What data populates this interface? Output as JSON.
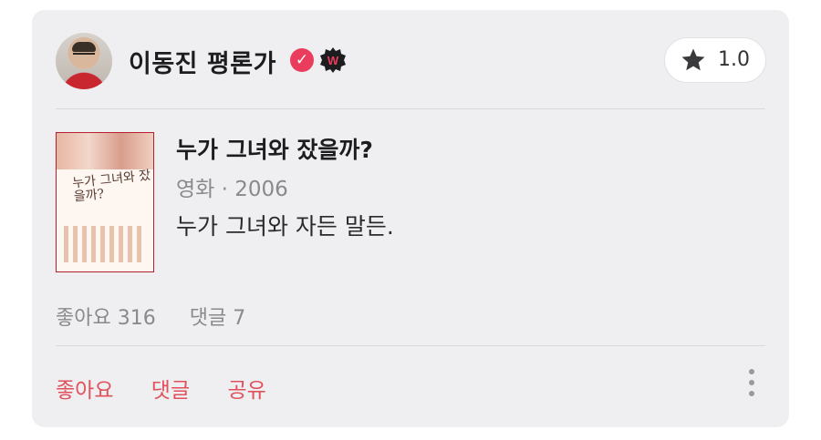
{
  "author": {
    "name": "이동진 평론가",
    "verified_icon": "check-badge-icon",
    "brand_badge": "W"
  },
  "rating": {
    "icon": "star-icon",
    "value": "1.0"
  },
  "movie": {
    "title": "누가 그녀와 잤을까?",
    "meta": "영화 · 2006",
    "poster_text": "누가 그녀와 잤을까?"
  },
  "review": {
    "text": "누가 그녀와 자든 말든."
  },
  "stats": {
    "likes_label": "좋아요 316",
    "comments_label": "댓글 7"
  },
  "actions": {
    "like": "좋아요",
    "comment": "댓글",
    "share": "공유",
    "more_icon": "more-vertical-icon"
  },
  "colors": {
    "accent": "#e0525b",
    "badge": "#ea3d5e",
    "card_bg": "#efeef0"
  }
}
